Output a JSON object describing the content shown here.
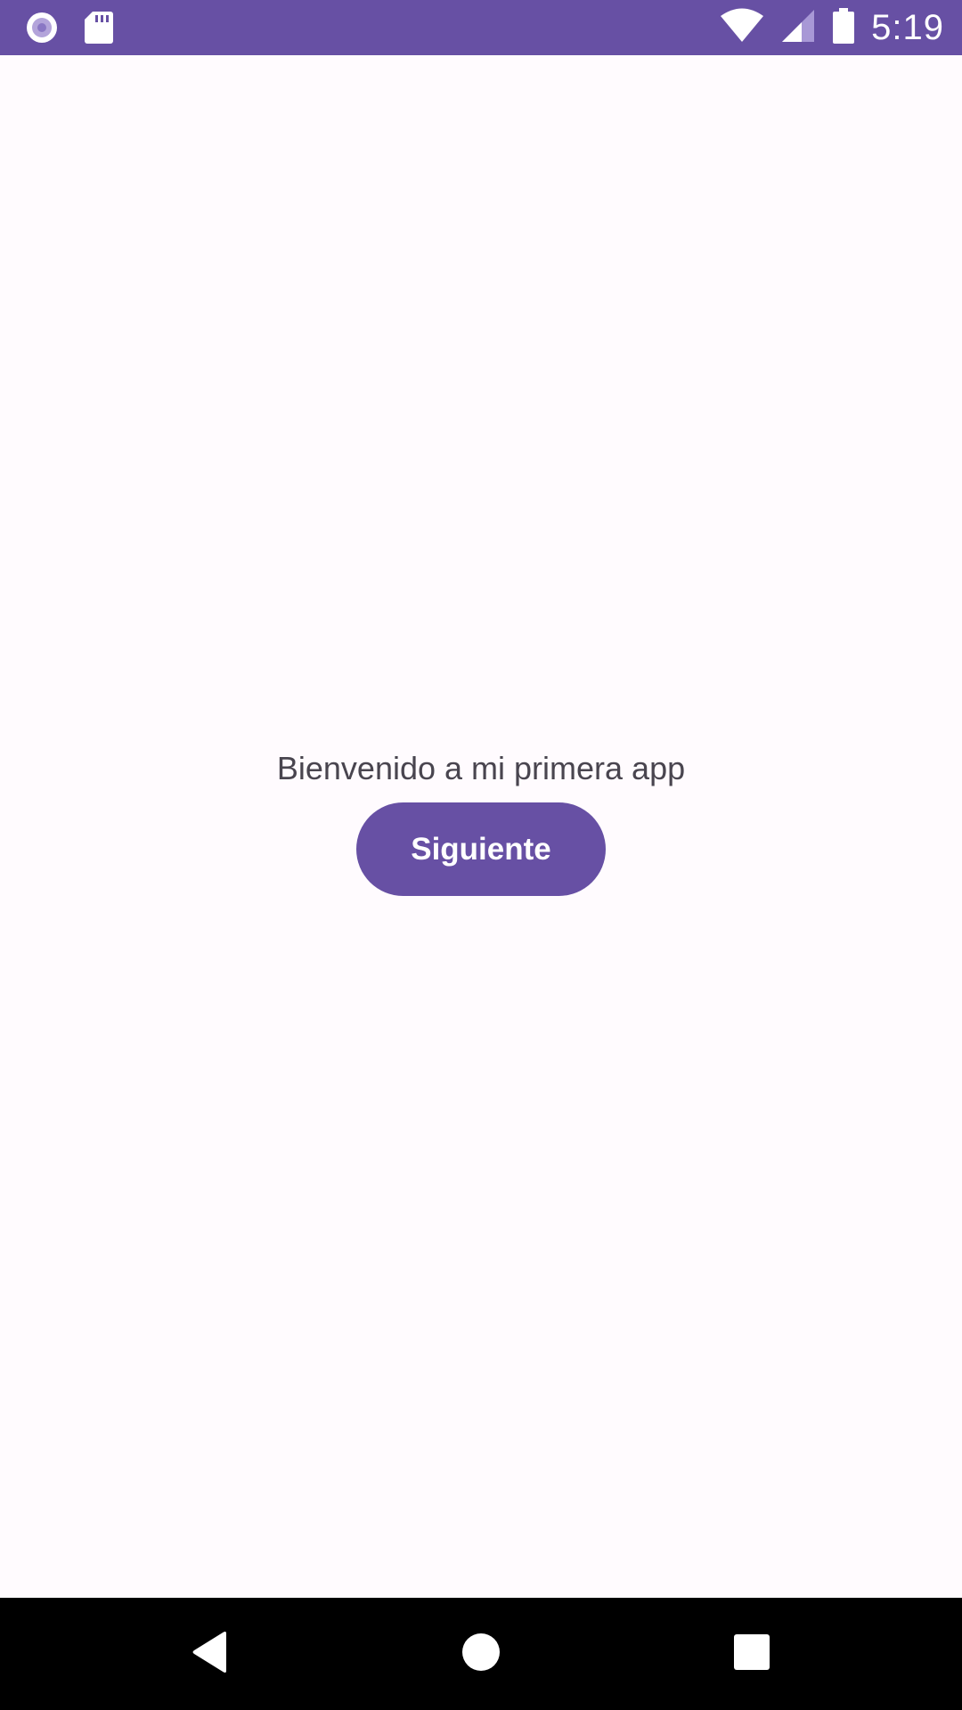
{
  "status_bar": {
    "time": "5:19",
    "background_color": "#6750a4",
    "icons": [
      "notification-record-icon",
      "sd-card-icon",
      "wifi-icon",
      "signal-icon",
      "battery-icon"
    ]
  },
  "main": {
    "welcome_text": "Bienvenido a mi primera app",
    "next_button_label": "Siguiente",
    "accent_color": "#6750a4",
    "background_color": "#fffbfe"
  },
  "nav_bar": {
    "icons": [
      "back-icon",
      "home-icon",
      "recents-icon"
    ]
  }
}
